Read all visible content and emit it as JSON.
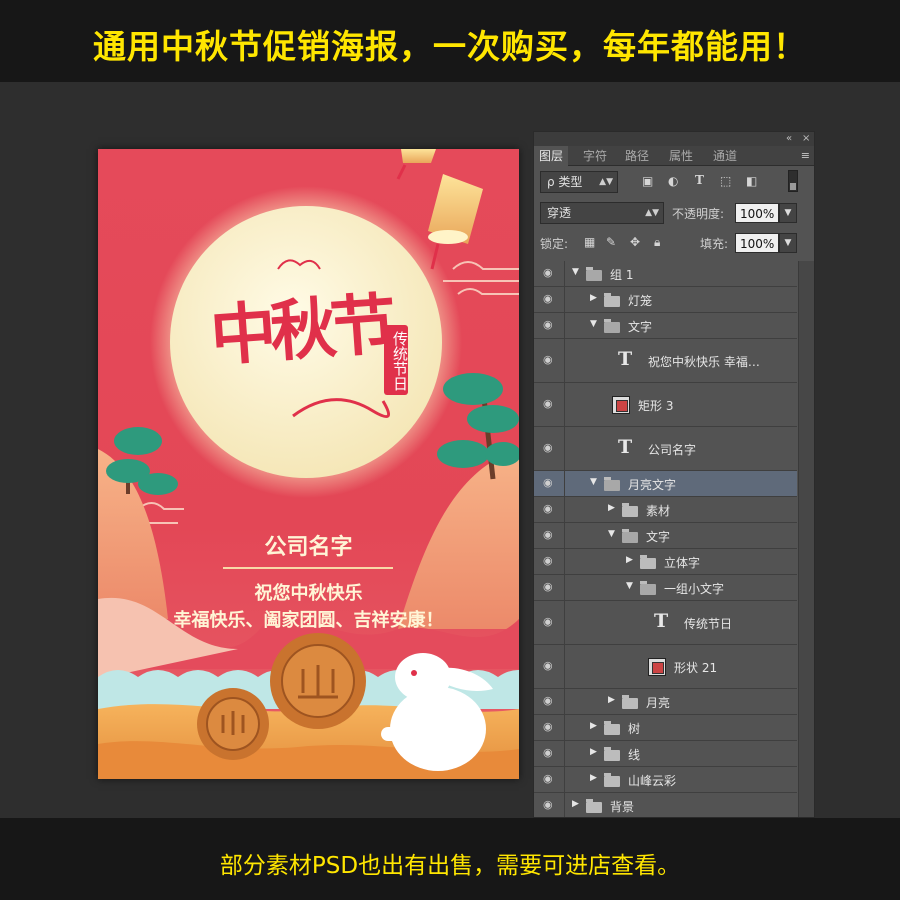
{
  "banner": {
    "headline": "通用中秋节促销海报，一次购买，每年都能用！",
    "footer": "部分素材PSD也出有出售，需要可进店查看。"
  },
  "poster": {
    "title": "中秋节",
    "seal_text": "传统节日",
    "company": "公司名字",
    "blessing_line1": "祝您中秋快乐",
    "blessing_line2": "幸福快乐、阖家团圆、吉祥安康！",
    "colors": {
      "background": "#e54a5a",
      "moon": "#fbf3d2",
      "title": "#e0304a",
      "mooncake": "#c9732e"
    }
  },
  "panel": {
    "controls": {
      "collapse": "«",
      "close": "×"
    },
    "tabs": [
      {
        "label": "图层",
        "active": true
      },
      {
        "label": "字符",
        "active": false
      },
      {
        "label": "路径",
        "active": false
      },
      {
        "label": "属性",
        "active": false
      },
      {
        "label": "通道",
        "active": false
      }
    ],
    "menu_icon": "≡",
    "filter": {
      "label": "ρ 类型",
      "icons": [
        "image-filter-icon",
        "adjustment-filter-icon",
        "type-filter-icon",
        "shape-filter-icon",
        "smart-object-filter-icon"
      ]
    },
    "blend_mode": "穿透",
    "opacity_label": "不透明度:",
    "opacity_value": "100%",
    "lock_label": "锁定:",
    "fill_label": "填充:",
    "fill_value": "100%",
    "layers": [
      {
        "name": "组 1",
        "kind": "folder",
        "expanded": true,
        "depth": 0
      },
      {
        "name": "灯笼",
        "kind": "folder",
        "expanded": false,
        "depth": 1
      },
      {
        "name": "文字",
        "kind": "folder",
        "expanded": true,
        "depth": 1
      },
      {
        "name": "祝您中秋快乐 幸福…",
        "kind": "text",
        "depth": 2
      },
      {
        "name": "矩形 3",
        "kind": "shape",
        "depth": 2
      },
      {
        "name": "公司名字",
        "kind": "text",
        "depth": 2
      },
      {
        "name": "月亮文字",
        "kind": "folder",
        "expanded": true,
        "depth": 1,
        "selected": true
      },
      {
        "name": "素材",
        "kind": "folder",
        "expanded": false,
        "depth": 2
      },
      {
        "name": "文字",
        "kind": "folder",
        "expanded": true,
        "depth": 2
      },
      {
        "name": "立体字",
        "kind": "folder",
        "expanded": false,
        "depth": 3
      },
      {
        "name": "一组小文字",
        "kind": "folder",
        "expanded": true,
        "depth": 3
      },
      {
        "name": "传统节日",
        "kind": "text",
        "depth": 4
      },
      {
        "name": "形状 21",
        "kind": "shape",
        "depth": 4
      },
      {
        "name": "月亮",
        "kind": "folder",
        "expanded": false,
        "depth": 2
      },
      {
        "name": "树",
        "kind": "folder",
        "expanded": false,
        "depth": 1
      },
      {
        "name": "线",
        "kind": "folder",
        "expanded": false,
        "depth": 1
      },
      {
        "name": "山峰云彩",
        "kind": "folder",
        "expanded": false,
        "depth": 1
      },
      {
        "name": "背景",
        "kind": "folder",
        "expanded": false,
        "depth": 0
      }
    ]
  }
}
